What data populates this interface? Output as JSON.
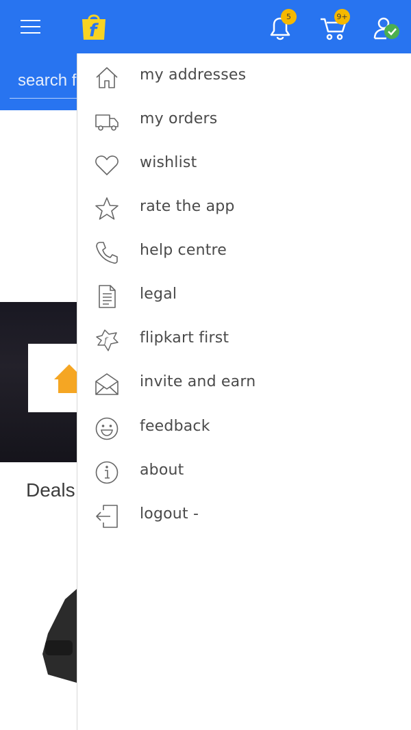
{
  "header": {
    "notifications_badge": "5",
    "cart_badge": "9+",
    "search_placeholder": "search for products"
  },
  "background": {
    "deals_title": "Deals"
  },
  "drawer": {
    "items": [
      {
        "label": "my addresses",
        "icon": "home-icon"
      },
      {
        "label": "my orders",
        "icon": "truck-icon"
      },
      {
        "label": "wishlist",
        "icon": "heart-icon"
      },
      {
        "label": "rate the app",
        "icon": "star-icon"
      },
      {
        "label": "help centre",
        "icon": "phone-icon"
      },
      {
        "label": "legal",
        "icon": "document-icon"
      },
      {
        "label": "flipkart first",
        "icon": "flipkart-first-icon"
      },
      {
        "label": "invite and earn",
        "icon": "envelope-icon"
      },
      {
        "label": "feedback",
        "icon": "smiley-icon"
      },
      {
        "label": "about",
        "icon": "info-icon"
      },
      {
        "label": "logout -",
        "icon": "logout-icon"
      }
    ]
  },
  "colors": {
    "brand_blue": "#2874f0",
    "badge_yellow": "#f5b800",
    "verified_green": "#4caf50",
    "accent_orange": "#f5a623"
  }
}
